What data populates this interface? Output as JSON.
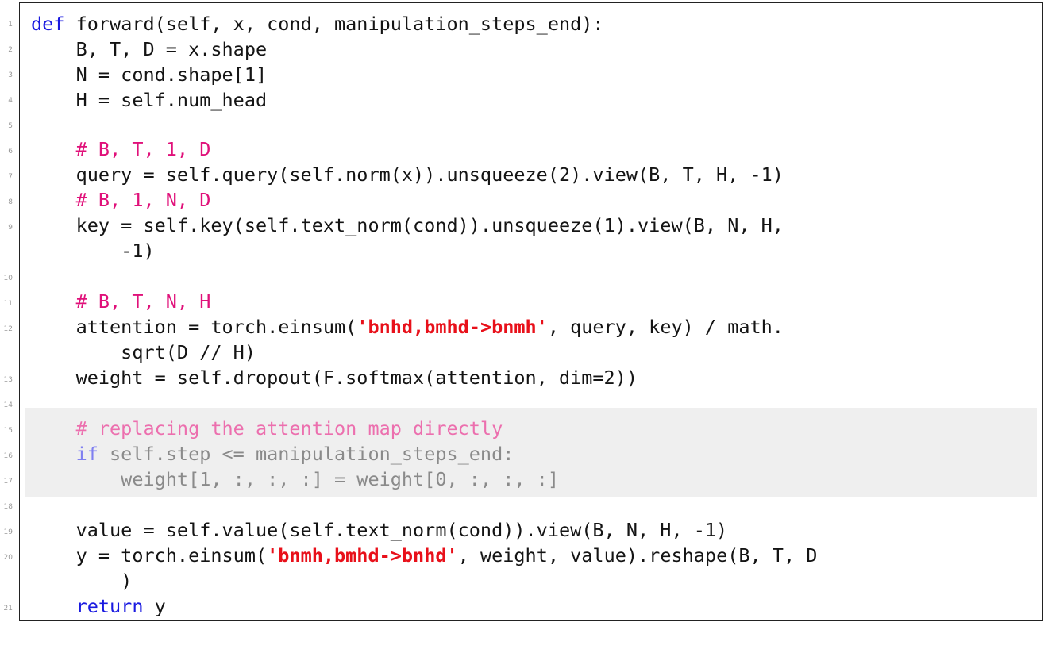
{
  "line_numbers": [
    "1",
    "2",
    "3",
    "4",
    "5",
    "6",
    "7",
    "8",
    "9",
    "10",
    "11",
    "12",
    "13",
    "14",
    "15",
    "16",
    "17",
    "18",
    "19",
    "20",
    "21"
  ],
  "code": {
    "l1": {
      "kw": "def",
      "rest": " forward(self, x, cond, manipulation_steps_end):"
    },
    "l2": "    B, T, D = x.shape",
    "l3": "    N = cond.shape[1]",
    "l4": "    H = self.num_head",
    "l6_comment": "# B, T, 1, D",
    "l7": "    query = self.query(self.norm(x)).unsqueeze(2).view(B, T, H, -1)",
    "l8_comment": "# B, 1, N, D",
    "l9": "    key = self.key(self.text_norm(cond)).unsqueeze(1).view(B, N, H,",
    "l9b": "        -1)",
    "l11_comment": "# B, T, N, H",
    "l12_pre": "    attention = torch.einsum(",
    "l12_str": "'bnhd,bmhd->bnmh'",
    "l12_post": ", query, key) / math.",
    "l12b": "        sqrt(D // H)",
    "l13": "    weight = self.dropout(F.softmax(attention, dim=2))",
    "l15_comment": "# replacing the attention map directly",
    "l16_kw": "if",
    "l16_rest": " self.step <= manipulation_steps_end:",
    "l17": "        weight[1, :, :, :] = weight[0, :, :, :]",
    "l19": "    value = self.value(self.text_norm(cond)).view(B, N, H, -1)",
    "l20_pre": "    y = torch.einsum(",
    "l20_str": "'bnmh,bmhd->bnhd'",
    "l20_post": ", weight, value).reshape(B, T, D",
    "l20b": "        )",
    "l21_kw": "return",
    "l21_rest": " y"
  },
  "colors": {
    "keyword": "#1a1ae0",
    "comment": "#e0117a",
    "string": "#e8101a",
    "highlight_background": "#efefef",
    "dimmed_text": "#8a8a8a"
  }
}
